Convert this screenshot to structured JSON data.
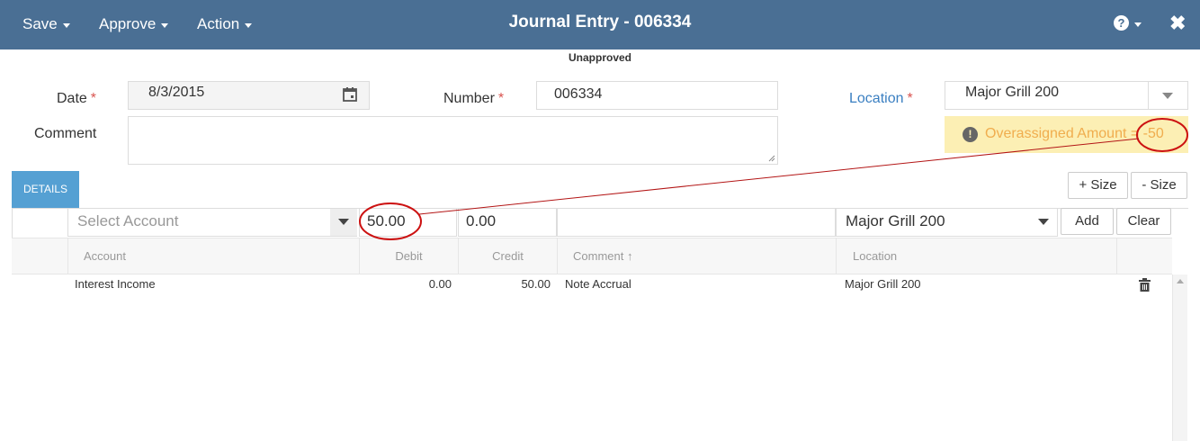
{
  "header": {
    "title": "Journal Entry - 006334",
    "menus": {
      "save": "Save",
      "approve": "Approve",
      "action": "Action"
    },
    "help_glyph": "?",
    "close_glyph": "✖"
  },
  "status": "Unapproved",
  "form": {
    "date_label": "Date",
    "date_value": "8/3/2015",
    "number_label": "Number",
    "number_value": "006334",
    "location_label": "Location",
    "location_value": "Major Grill 200",
    "comment_label": "Comment",
    "comment_value": "",
    "required_mark": "*"
  },
  "warning": {
    "icon_glyph": "!",
    "text": "Overassigned Amount = -50"
  },
  "details_tab": "DETAILS",
  "size_buttons": {
    "plus": "+ Size",
    "minus": "- Size"
  },
  "entry_row": {
    "account_placeholder": "Select Account",
    "debit": "50.00",
    "credit": "0.00",
    "comment": "",
    "location": "Major Grill 200",
    "add": "Add",
    "clear": "Clear"
  },
  "table": {
    "columns": [
      "Account",
      "Debit",
      "Credit",
      "Comment ↑",
      "Location"
    ],
    "rows": [
      {
        "account": "Interest Income",
        "debit": "0.00",
        "credit": "50.00",
        "comment": "Note Accrual",
        "location": "Major Grill 200"
      }
    ]
  },
  "colors": {
    "topbar": "#4a6f94",
    "details_tab": "#55a0d3",
    "warning_bg": "#fcefb4",
    "warning_text": "#f0ad4e",
    "required": "#d9534f",
    "annotation": "#cc1111"
  }
}
